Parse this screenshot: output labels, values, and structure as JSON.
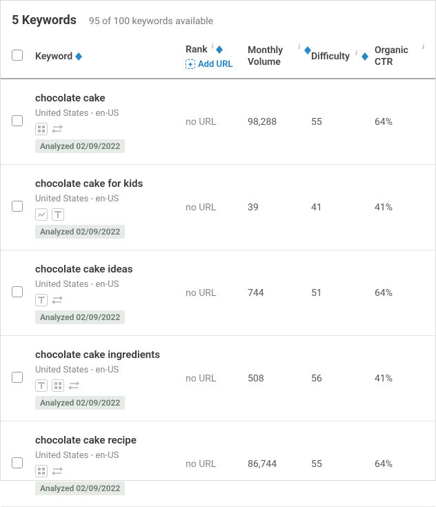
{
  "header": {
    "title": "5 Keywords",
    "subtitle": "95 of 100 keywords available"
  },
  "columns": {
    "keyword": "Keyword",
    "rank": "Rank",
    "add_url": "Add URL",
    "volume": "Monthly Volume",
    "difficulty": "Difficulty",
    "ctr": "Organic CTR"
  },
  "rows": [
    {
      "keyword": "chocolate cake",
      "location": "United States - en-US",
      "analyzed": "Analyzed 02/09/2022",
      "rank": "no URL",
      "volume": "98,288",
      "difficulty": "55",
      "ctr": "64%",
      "icons": [
        "grid",
        "swap"
      ]
    },
    {
      "keyword": "chocolate cake for kids",
      "location": "United States - en-US",
      "analyzed": "Analyzed 02/09/2022",
      "rank": "no URL",
      "volume": "39",
      "difficulty": "41",
      "ctr": "41%",
      "icons": [
        "image",
        "text"
      ]
    },
    {
      "keyword": "chocolate cake ideas",
      "location": "United States - en-US",
      "analyzed": "Analyzed 02/09/2022",
      "rank": "no URL",
      "volume": "744",
      "difficulty": "51",
      "ctr": "64%",
      "icons": [
        "text",
        "swap"
      ]
    },
    {
      "keyword": "chocolate cake ingredients",
      "location": "United States - en-US",
      "analyzed": "Analyzed 02/09/2022",
      "rank": "no URL",
      "volume": "508",
      "difficulty": "56",
      "ctr": "41%",
      "icons": [
        "text",
        "grid",
        "swap"
      ]
    },
    {
      "keyword": "chocolate cake recipe",
      "location": "United States - en-US",
      "analyzed": "Analyzed 02/09/2022",
      "rank": "no URL",
      "volume": "86,744",
      "difficulty": "55",
      "ctr": "64%",
      "icons": [
        "grid",
        "swap"
      ]
    }
  ]
}
